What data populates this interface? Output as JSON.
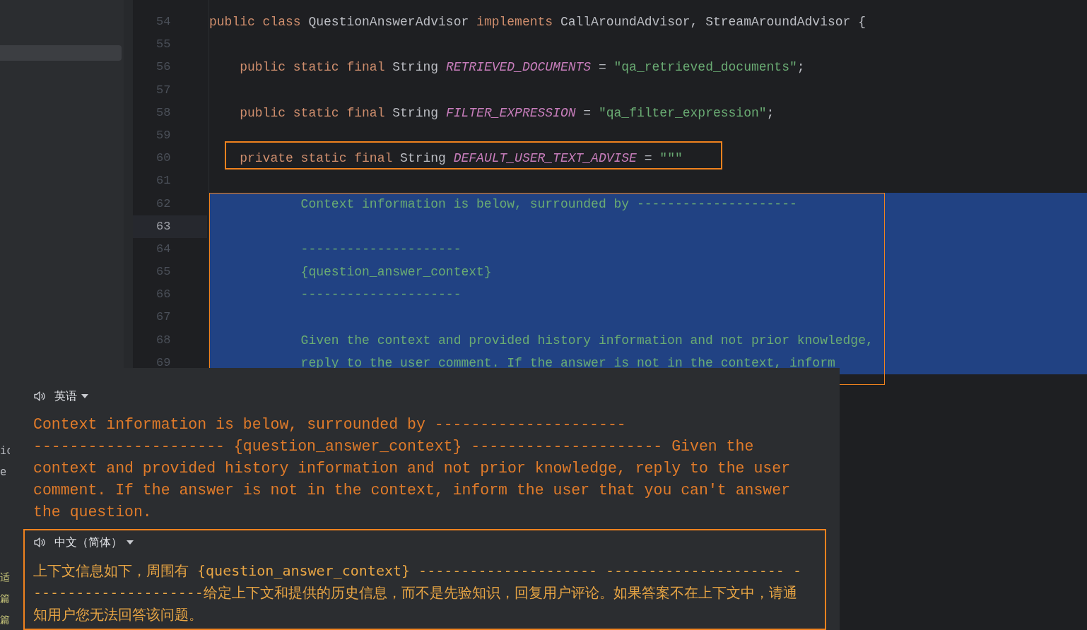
{
  "sidebar": {
    "fragments": [
      {
        "text": "ic",
        "kind": "plain"
      },
      {
        "text": "e",
        "kind": "plain"
      },
      {
        "text": "适",
        "kind": "string"
      },
      {
        "text": "篇",
        "kind": "string"
      },
      {
        "text": "篇",
        "kind": "string"
      }
    ]
  },
  "editor": {
    "selection_framed": true,
    "lines": [
      {
        "number": "54",
        "current": false,
        "selected": false,
        "framed": false,
        "tokens": [
          {
            "kind": "keyword",
            "text": "public class "
          },
          {
            "kind": "plain",
            "text": "QuestionAnswerAdvisor "
          },
          {
            "kind": "keyword",
            "text": "implements "
          },
          {
            "kind": "plain",
            "text": "CallAroundAdvisor, StreamAroundAdvisor {"
          }
        ]
      },
      {
        "number": "55",
        "current": false,
        "selected": false,
        "framed": false
      },
      {
        "number": "56",
        "current": false,
        "selected": false,
        "framed": false,
        "tokens": [
          {
            "kind": "keyword",
            "text": "    public static final "
          },
          {
            "kind": "plain",
            "text": "String "
          },
          {
            "kind": "constant",
            "text": "RETRIEVED_DOCUMENTS"
          },
          {
            "kind": "plain",
            "text": " = "
          },
          {
            "kind": "string",
            "text": "\"qa_retrieved_documents\""
          },
          {
            "kind": "plain",
            "text": ";"
          }
        ]
      },
      {
        "number": "57",
        "current": false,
        "selected": false,
        "framed": false
      },
      {
        "number": "58",
        "current": false,
        "selected": false,
        "framed": false,
        "tokens": [
          {
            "kind": "keyword",
            "text": "    public static final "
          },
          {
            "kind": "plain",
            "text": "String "
          },
          {
            "kind": "constant",
            "text": "FILTER_EXPRESSION"
          },
          {
            "kind": "plain",
            "text": " = "
          },
          {
            "kind": "string",
            "text": "\"qa_filter_expression\""
          },
          {
            "kind": "plain",
            "text": ";"
          }
        ]
      },
      {
        "number": "59",
        "current": false,
        "selected": false,
        "framed": false
      },
      {
        "number": "60",
        "current": false,
        "selected": false,
        "framed": true,
        "tokens": [
          {
            "kind": "keyword",
            "text": "    private static final "
          },
          {
            "kind": "plain",
            "text": "String "
          },
          {
            "kind": "constant",
            "text": "DEFAULT_USER_TEXT_ADVISE"
          },
          {
            "kind": "plain",
            "text": " = "
          },
          {
            "kind": "string",
            "text": "\"\"\""
          }
        ]
      },
      {
        "number": "61",
        "current": false,
        "selected": false,
        "framed": false
      },
      {
        "number": "62",
        "current": false,
        "selected": true,
        "framed": false,
        "tokens": [
          {
            "kind": "string",
            "text": "            Context information is below, surrounded by ---------------------"
          }
        ]
      },
      {
        "number": "63",
        "current": true,
        "selected": true,
        "framed": false
      },
      {
        "number": "64",
        "current": false,
        "selected": true,
        "framed": false,
        "tokens": [
          {
            "kind": "string",
            "text": "            ---------------------"
          }
        ]
      },
      {
        "number": "65",
        "current": false,
        "selected": true,
        "framed": false,
        "tokens": [
          {
            "kind": "string",
            "text": "            {question_answer_context}"
          }
        ]
      },
      {
        "number": "66",
        "current": false,
        "selected": true,
        "framed": false,
        "tokens": [
          {
            "kind": "string",
            "text": "            ---------------------"
          }
        ]
      },
      {
        "number": "67",
        "current": false,
        "selected": true,
        "framed": false
      },
      {
        "number": "68",
        "current": false,
        "selected": true,
        "framed": false,
        "tokens": [
          {
            "kind": "string",
            "text": "            Given the context and provided history information and not prior knowledge,"
          }
        ]
      },
      {
        "number": "69",
        "current": false,
        "selected": true,
        "framed": false,
        "tokens": [
          {
            "kind": "string",
            "text": "            reply to the user comment. If the answer is not in the context, inform"
          }
        ]
      }
    ]
  },
  "translation_popup": {
    "sections": [
      {
        "language": "英语",
        "kind": "source",
        "framed": false,
        "text": "Context information is below, surrounded by --------------------- --------------------- {question_answer_context} --------------------- Given the context and provided history information and not prior knowledge, reply to the user comment. If the answer is not in the context, inform the user that you can't answer the question."
      },
      {
        "language": "中文（简体）",
        "kind": "target",
        "framed": true,
        "text": "上下文信息如下，周围有 {question_answer_context} --------------------- --------------------- ---------------------给定上下文和提供的历史信息，而不是先验知识，回复用户评论。如果答案不在上下文中，请通知用户您无法回答该问题。"
      }
    ]
  }
}
